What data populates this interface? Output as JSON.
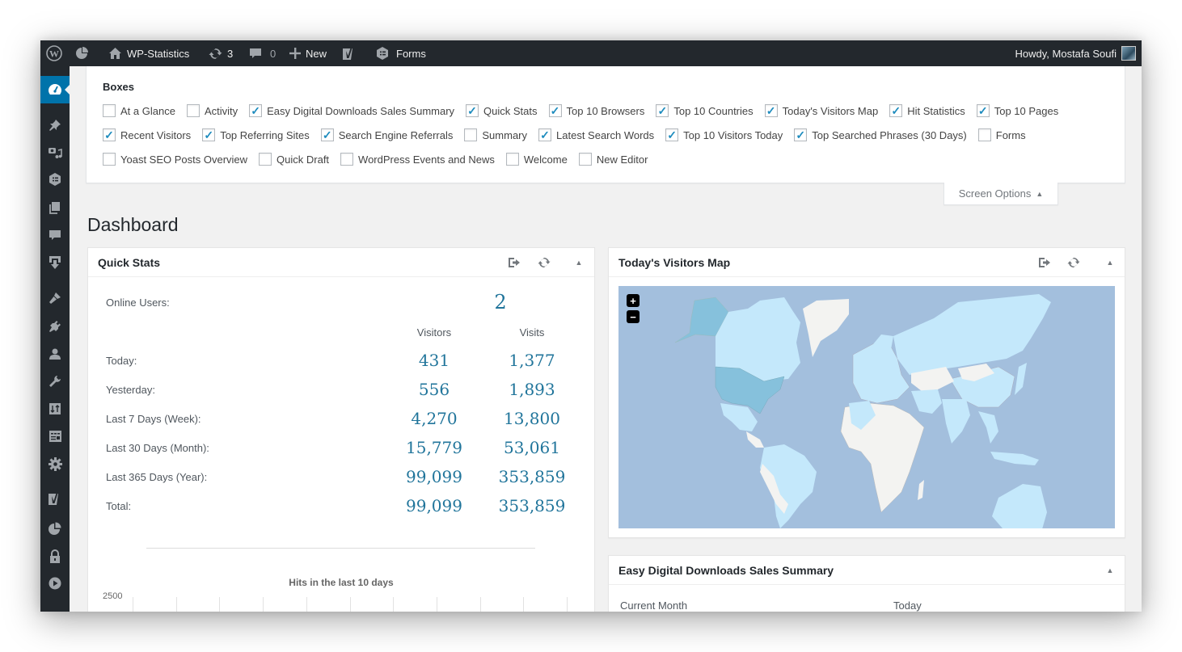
{
  "admin_bar": {
    "site_name": "WP-Statistics",
    "updates_count": "3",
    "comments_count": "0",
    "new_label": "New",
    "forms_label": "Forms",
    "greeting": "Howdy, Mostafa Soufi"
  },
  "sidebar": {
    "items": [
      {
        "icon": "dashboard-icon",
        "active": true
      },
      {
        "icon": "pin-icon"
      },
      {
        "icon": "media-icon"
      },
      {
        "icon": "forms-icon"
      },
      {
        "icon": "pages-icon"
      },
      {
        "icon": "comments-icon"
      },
      {
        "icon": "downloads-icon"
      },
      {
        "icon": "appearance-icon"
      },
      {
        "icon": "plugins-icon"
      },
      {
        "icon": "users-icon"
      },
      {
        "icon": "tools-icon"
      },
      {
        "icon": "settings-sliders-icon"
      },
      {
        "icon": "layout-icon"
      },
      {
        "icon": "settings-gear-icon"
      },
      {
        "icon": "yoast-icon"
      },
      {
        "icon": "statistics-pie-icon"
      },
      {
        "icon": "lock-icon"
      },
      {
        "icon": "play-icon"
      }
    ]
  },
  "screen_options": {
    "title": "Boxes",
    "tab_label": "Screen Options",
    "rows": [
      [
        {
          "label": "At a Glance",
          "checked": false
        },
        {
          "label": "Activity",
          "checked": false
        },
        {
          "label": "Easy Digital Downloads Sales Summary",
          "checked": true
        },
        {
          "label": "Quick Stats",
          "checked": true
        },
        {
          "label": "Top 10 Browsers",
          "checked": true
        },
        {
          "label": "Top 10 Countries",
          "checked": true
        },
        {
          "label": "Today's Visitors Map",
          "checked": true
        },
        {
          "label": "Hit Statistics",
          "checked": true
        },
        {
          "label": "Top 10 Pages",
          "checked": true
        }
      ],
      [
        {
          "label": "Recent Visitors",
          "checked": true
        },
        {
          "label": "Top Referring Sites",
          "checked": true
        },
        {
          "label": "Search Engine Referrals",
          "checked": true
        },
        {
          "label": "Summary",
          "checked": false
        },
        {
          "label": "Latest Search Words",
          "checked": true
        },
        {
          "label": "Top 10 Visitors Today",
          "checked": true
        },
        {
          "label": "Top Searched Phrases (30 Days)",
          "checked": true
        },
        {
          "label": "Forms",
          "checked": false
        }
      ],
      [
        {
          "label": "Yoast SEO Posts Overview",
          "checked": false
        },
        {
          "label": "Quick Draft",
          "checked": false
        },
        {
          "label": "WordPress Events and News",
          "checked": false
        },
        {
          "label": "Welcome",
          "checked": false
        },
        {
          "label": "New Editor",
          "checked": false
        }
      ]
    ]
  },
  "page": {
    "title": "Dashboard"
  },
  "quick_stats": {
    "title": "Quick Stats",
    "online_label": "Online Users:",
    "online_value": "2",
    "col_visitors": "Visitors",
    "col_visits": "Visits",
    "rows": [
      {
        "label": "Today:",
        "visitors": "431",
        "visits": "1,377"
      },
      {
        "label": "Yesterday:",
        "visitors": "556",
        "visits": "1,893"
      },
      {
        "label": "Last 7 Days (Week):",
        "visitors": "4,270",
        "visits": "13,800"
      },
      {
        "label": "Last 30 Days (Month):",
        "visitors": "15,779",
        "visits": "53,061"
      },
      {
        "label": "Last 365 Days (Year):",
        "visitors": "99,099",
        "visits": "353,859"
      },
      {
        "label": "Total:",
        "visitors": "99,099",
        "visits": "353,859"
      }
    ],
    "chart": {
      "title": "Hits in the last 10 days",
      "y_top_tick": "2500"
    }
  },
  "visitors_map": {
    "title": "Today's Visitors Map",
    "zoom_in": "+",
    "zoom_out": "−",
    "colors": {
      "ocean": "#a3bfdd",
      "visited": "#c4e8fb",
      "top_country": "#86c1dc",
      "no_visits": "#f3f3f1"
    }
  },
  "edd_summary": {
    "title": "Easy Digital Downloads Sales Summary",
    "col_current_month": "Current Month",
    "col_today": "Today"
  },
  "colors": {
    "admin_bar": "#23282d",
    "accent": "#0073aa",
    "stat_value": "#21759b"
  }
}
